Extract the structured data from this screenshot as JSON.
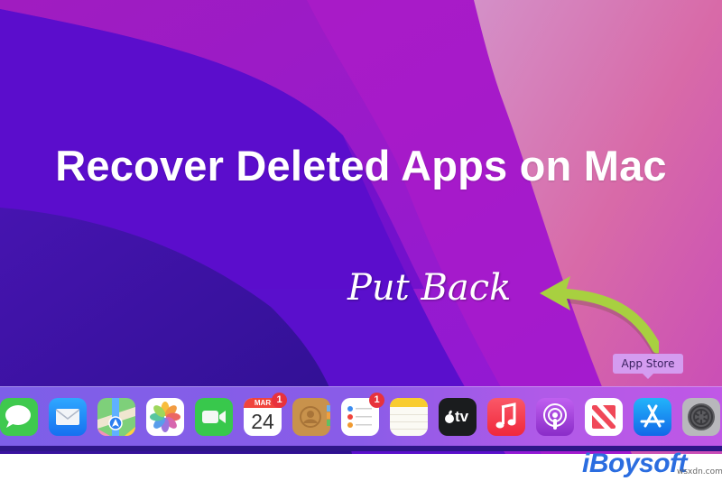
{
  "headline": "Recover Deleted Apps on Mac",
  "annotation": "Put Back",
  "tooltip": "App Store",
  "dock": {
    "items": [
      {
        "name": "Messages",
        "badge": null
      },
      {
        "name": "Mail",
        "badge": null
      },
      {
        "name": "Maps",
        "badge": null
      },
      {
        "name": "Photos",
        "badge": null
      },
      {
        "name": "FaceTime",
        "badge": null
      },
      {
        "name": "Calendar",
        "badge": "1",
        "month": "MAR",
        "day": "24"
      },
      {
        "name": "Contacts",
        "badge": null
      },
      {
        "name": "Reminders",
        "badge": "1"
      },
      {
        "name": "Notes",
        "badge": null
      },
      {
        "name": "Apple TV",
        "badge": null,
        "label": "tv"
      },
      {
        "name": "Music",
        "badge": null
      },
      {
        "name": "Podcasts",
        "badge": null
      },
      {
        "name": "News",
        "badge": null
      },
      {
        "name": "App Store",
        "badge": null
      },
      {
        "name": "System Preferences",
        "badge": null
      }
    ]
  },
  "brand": {
    "logo": "iBoysoft",
    "watermark": "wsxdn.com"
  },
  "colors": {
    "arrow": "#a8d040",
    "logo": "#2b6de0",
    "badge": "#e8323c"
  }
}
